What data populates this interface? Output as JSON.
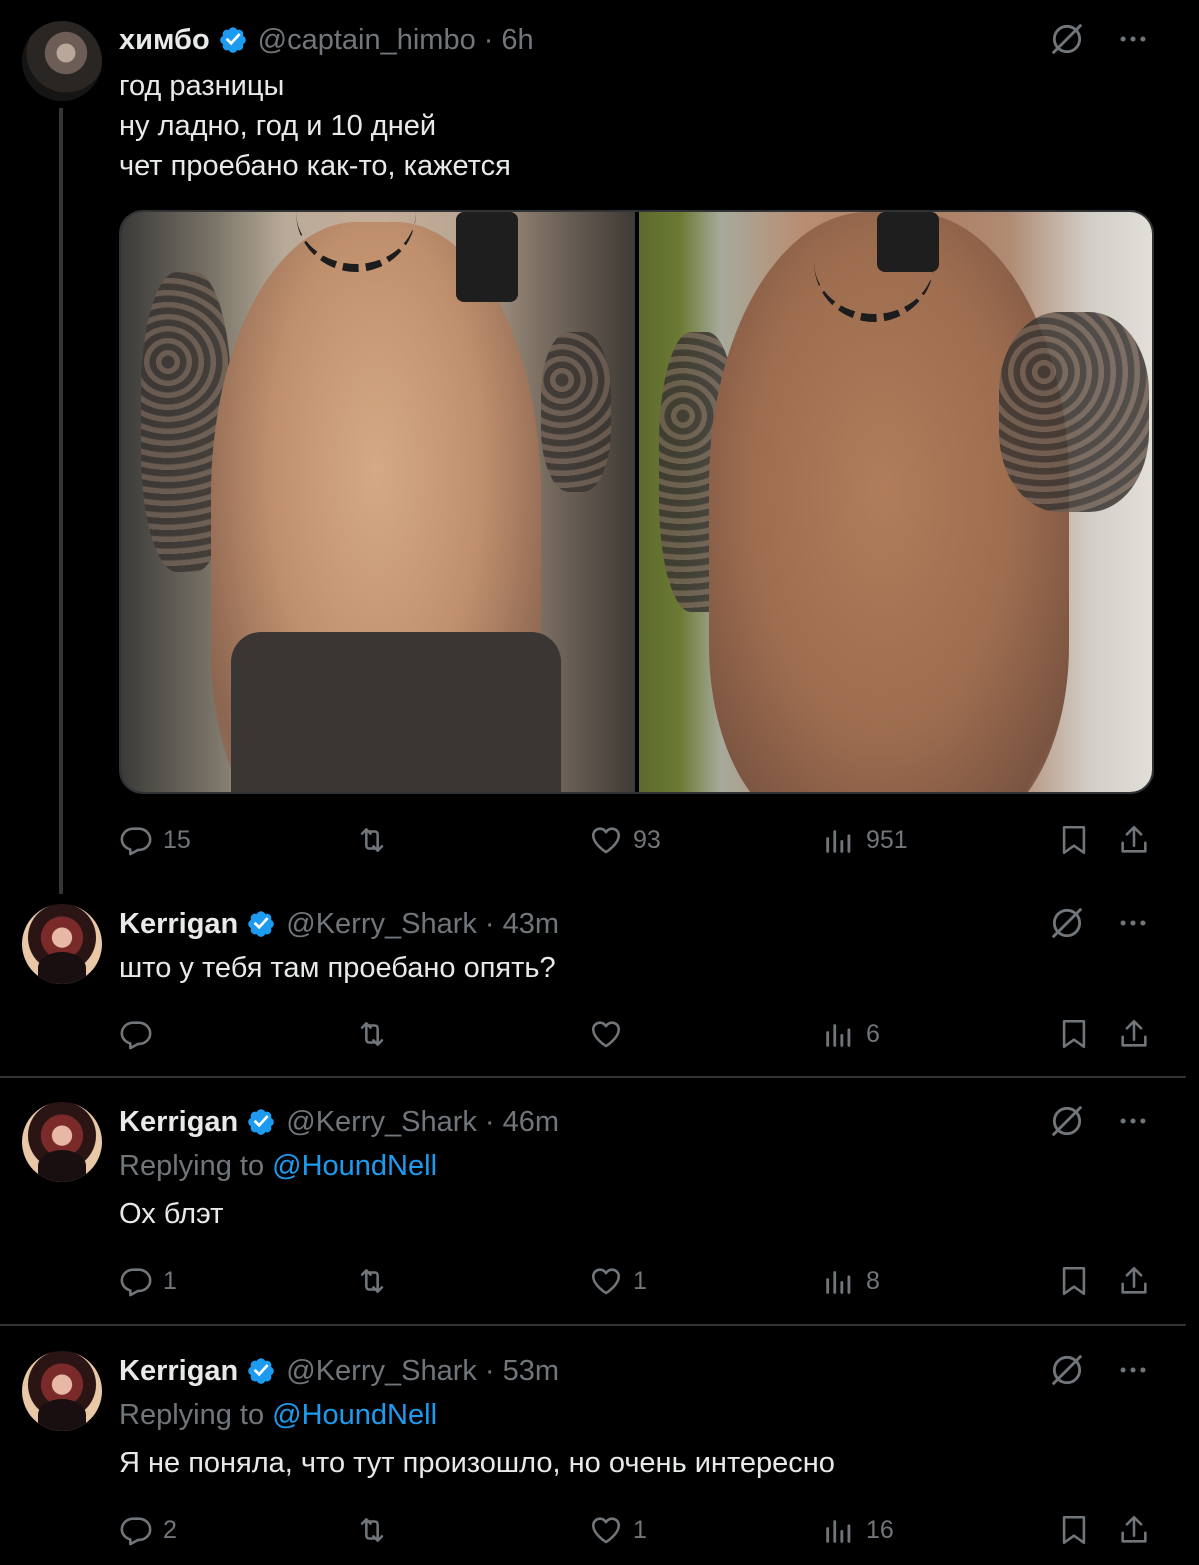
{
  "tweets": [
    {
      "name": "химбо",
      "handle": "@captain_himbo",
      "separator": "·",
      "time": "6h",
      "text": "год разницы\nну ладно, год и 10 дней\nчет проебано как-то, кажется",
      "actions": {
        "replies": "15",
        "retweets": "",
        "likes": "93",
        "views": "951"
      }
    },
    {
      "name": "Kerrigan",
      "handle": "@Kerry_Shark",
      "separator": "·",
      "time": "43m",
      "text": "што у тебя там проебано опять?",
      "actions": {
        "replies": "",
        "retweets": "",
        "likes": "",
        "views": "6"
      }
    },
    {
      "name": "Kerrigan",
      "handle": "@Kerry_Shark",
      "separator": "·",
      "time": "46m",
      "replying_prefix": "Replying to",
      "replying_to": "@HoundNell",
      "text": "Ох блэт",
      "actions": {
        "replies": "1",
        "retweets": "",
        "likes": "1",
        "views": "8"
      }
    },
    {
      "name": "Kerrigan",
      "handle": "@Kerry_Shark",
      "separator": "·",
      "time": "53m",
      "replying_prefix": "Replying to",
      "replying_to": "@HoundNell",
      "text": "Я не поняла, что тут произошло, но очень интересно",
      "actions": {
        "replies": "2",
        "retweets": "",
        "likes": "1",
        "views": "16"
      }
    }
  ],
  "colors": {
    "background": "#000000",
    "text": "#e7e9ea",
    "secondary": "#71767b",
    "link": "#1d9bf0",
    "verified": "#1d9bf0",
    "divider": "#2f3336"
  },
  "icons": [
    "verified-badge-icon",
    "grok-icon",
    "more-icon",
    "reply-icon",
    "retweet-icon",
    "like-icon",
    "views-icon",
    "bookmark-icon",
    "share-icon"
  ]
}
